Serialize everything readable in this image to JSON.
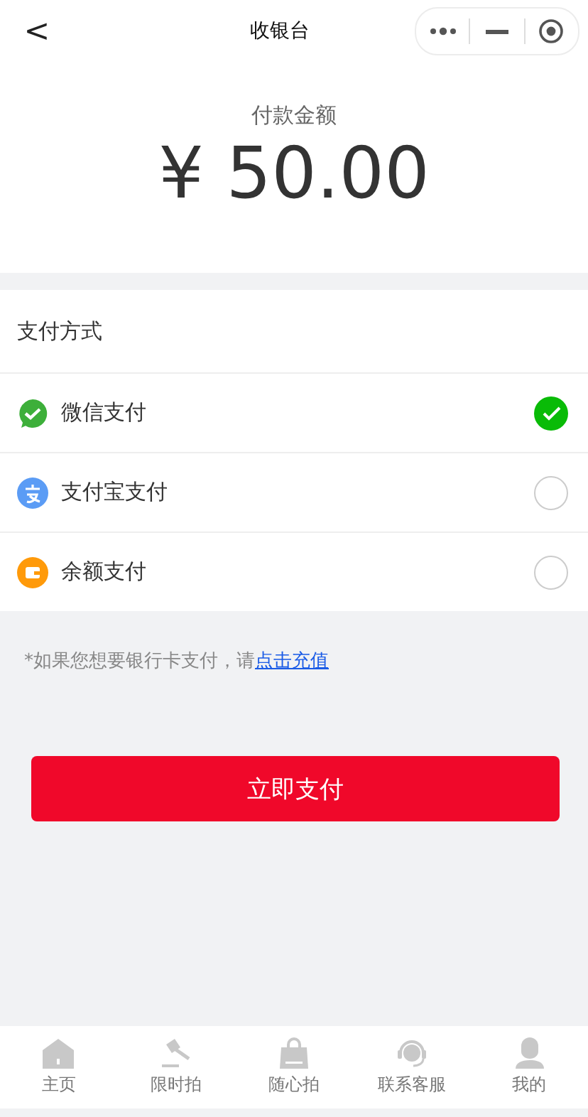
{
  "nav": {
    "back": "<",
    "title": "收银台"
  },
  "amount": {
    "label": "付款金额",
    "value": "¥ 50.00"
  },
  "methods_title": "支付方式",
  "methods": [
    {
      "kind": "wechat",
      "label": "微信支付",
      "selected": true
    },
    {
      "kind": "alipay",
      "label": "支付宝支付",
      "selected": false
    },
    {
      "kind": "balance",
      "label": "余额支付",
      "selected": false
    }
  ],
  "note": {
    "text": "*如果您想要银行卡支付，请",
    "link": "点击充值"
  },
  "pay_button": "立即支付",
  "tabs": [
    {
      "kind": "home",
      "label": "主页",
      "selected": false
    },
    {
      "kind": "auction",
      "label": "限时拍",
      "selected": false
    },
    {
      "kind": "bag",
      "label": "随心拍",
      "selected": false
    },
    {
      "kind": "support",
      "label": "联系客服",
      "selected": false
    },
    {
      "kind": "user",
      "label": "我的",
      "selected": false
    }
  ]
}
